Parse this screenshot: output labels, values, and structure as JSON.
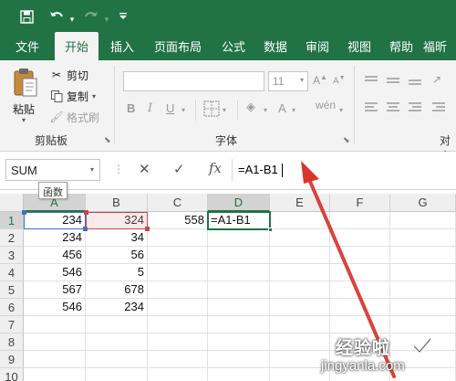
{
  "colors": {
    "excel_green": "#217346",
    "ref_a_border": "#3a72c4",
    "ref_b_border": "#c9464f",
    "arrow": "#d9342b"
  },
  "qat": {
    "icons": [
      "save-icon",
      "undo-icon",
      "redo-icon",
      "customize-icon"
    ]
  },
  "tabs": [
    {
      "label": "文件"
    },
    {
      "label": "开始"
    },
    {
      "label": "插入"
    },
    {
      "label": "页面布局"
    },
    {
      "label": "公式"
    },
    {
      "label": "数据"
    },
    {
      "label": "审阅"
    },
    {
      "label": "视图"
    },
    {
      "label": "帮助"
    },
    {
      "label": "福昕"
    },
    {
      "label": "福昕"
    }
  ],
  "ribbon": {
    "clipboard": {
      "paste": "粘贴",
      "cut": "剪切",
      "copy": "复制",
      "format_painter": "格式刷",
      "group_label": "剪贴板"
    },
    "font": {
      "font_name": "",
      "font_size": "11",
      "group_label": "字体",
      "bold": "B",
      "italic": "I",
      "underline": "U",
      "grow": "A",
      "shrink": "A"
    },
    "align": {
      "group_label": "对齐"
    }
  },
  "formula_bar": {
    "name_box": "SUM",
    "cancel": "✕",
    "enter": "✓",
    "fx": "fx",
    "formula": "=A1-B1",
    "tooltip": "函数"
  },
  "grid": {
    "columns": [
      "A",
      "B",
      "C",
      "D",
      "E",
      "F",
      "G"
    ],
    "rows": [
      "1",
      "2",
      "3",
      "4",
      "5",
      "6",
      "7",
      "8",
      "9",
      "10"
    ],
    "cells": {
      "A1": "234",
      "B1": "324",
      "C1": "558",
      "D1": "=A1-B1",
      "A2": "234",
      "B2": "34",
      "A3": "456",
      "B3": "56",
      "A4": "546",
      "B4": "5",
      "A5": "567",
      "B5": "678",
      "A6": "546",
      "B6": "234"
    }
  },
  "watermark": {
    "text": "经验啦",
    "url": "jingyanla.com"
  }
}
